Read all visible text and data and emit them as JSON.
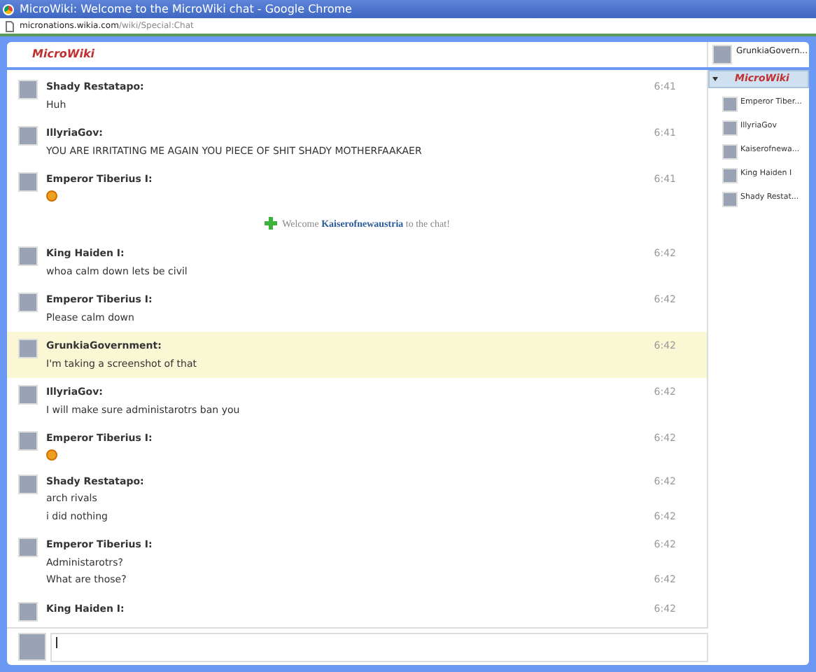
{
  "window": {
    "title": "MicroWiki: Welcome to the MicroWiki chat - Google Chrome"
  },
  "address_bar": {
    "host": "micronations.wikia.com",
    "path": "/wiki/Special:Chat"
  },
  "header": {
    "logo": "MicroWiki",
    "current_user": "GrunkiaGovern..."
  },
  "messages": [
    {
      "kind": "message",
      "user": "Shady Restatapo:",
      "time": "6:41",
      "highlighted": false,
      "lines": [
        {
          "kind": "text",
          "text": "Huh"
        }
      ]
    },
    {
      "kind": "message",
      "user": "IllyriaGov:",
      "time": "6:41",
      "highlighted": false,
      "lines": [
        {
          "kind": "text",
          "text": "YOU ARE IRRITATING ME AGAIN YOU PIECE OF SHIT SHADY MOTHERFAAKAER"
        }
      ]
    },
    {
      "kind": "message",
      "user": "Emperor Tiberius I:",
      "time": "6:41",
      "highlighted": false,
      "lines": [
        {
          "kind": "emoji"
        }
      ]
    },
    {
      "kind": "notice",
      "before": "Welcome",
      "user": "Kaiserofnewaustria",
      "after": "to the chat!"
    },
    {
      "kind": "message",
      "user": "King Haiden I:",
      "time": "6:42",
      "highlighted": false,
      "lines": [
        {
          "kind": "text",
          "text": "whoa calm down lets be civil"
        }
      ]
    },
    {
      "kind": "message",
      "user": "Emperor Tiberius I:",
      "time": "6:42",
      "highlighted": false,
      "lines": [
        {
          "kind": "text",
          "text": "Please calm down"
        }
      ]
    },
    {
      "kind": "message",
      "user": "GrunkiaGovernment:",
      "time": "6:42",
      "highlighted": true,
      "lines": [
        {
          "kind": "text",
          "text": "I'm taking a screenshot of that"
        }
      ]
    },
    {
      "kind": "message",
      "user": "IllyriaGov:",
      "time": "6:42",
      "highlighted": false,
      "lines": [
        {
          "kind": "text",
          "text": "I will make sure administarotrs ban you"
        }
      ]
    },
    {
      "kind": "message",
      "user": "Emperor Tiberius I:",
      "time": "6:42",
      "highlighted": false,
      "lines": [
        {
          "kind": "emoji"
        }
      ]
    },
    {
      "kind": "message",
      "user": "Shady Restatapo:",
      "time": "6:42",
      "highlighted": false,
      "lines": [
        {
          "kind": "text",
          "text": "arch rivals"
        },
        {
          "kind": "text",
          "text": "i did nothing",
          "time": "6:42"
        }
      ]
    },
    {
      "kind": "message",
      "user": "Emperor Tiberius I:",
      "time": "6:42",
      "highlighted": false,
      "lines": [
        {
          "kind": "text",
          "text": "Administarotrs?"
        },
        {
          "kind": "text",
          "text": "What are those?",
          "time": "6:42"
        }
      ]
    },
    {
      "kind": "message",
      "user": "King Haiden I:",
      "time": "6:42",
      "highlighted": false
    }
  ],
  "sidebar": {
    "room": "MicroWiki",
    "expanded": true,
    "users": [
      {
        "name": "Emperor Tiber..."
      },
      {
        "name": "IllyriaGov"
      },
      {
        "name": "Kaiserofnewa..."
      },
      {
        "name": "King Haiden I"
      },
      {
        "name": "Shady Restat..."
      }
    ]
  }
}
